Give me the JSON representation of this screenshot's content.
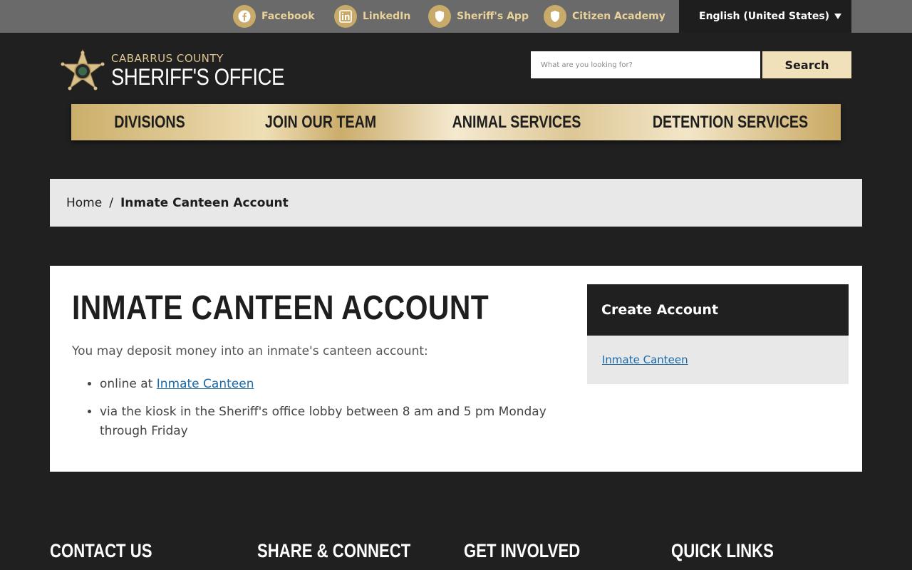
{
  "topbar": {
    "links": [
      {
        "label": "Facebook",
        "icon": "facebook-icon"
      },
      {
        "label": "LinkedIn",
        "icon": "linkedin-icon"
      },
      {
        "label": "Sheriff's App",
        "icon": "shield-icon"
      },
      {
        "label": "Citizen Academy",
        "icon": "shield-icon"
      }
    ],
    "language": "English (United States)"
  },
  "logo": {
    "line1": "CABARRUS COUNTY",
    "line2": "SHERIFF'S OFFICE"
  },
  "search": {
    "placeholder": "What are you looking for?",
    "button_label": "Search"
  },
  "nav": {
    "items": [
      "DIVISIONS",
      "JOIN OUR TEAM",
      "ANIMAL SERVICES",
      "DETENTION SERVICES"
    ]
  },
  "breadcrumb": {
    "home": "Home",
    "separator": "/",
    "current": "Inmate Canteen Account"
  },
  "main": {
    "title": "INMATE CANTEEN ACCOUNT",
    "intro": "You may deposit money into an inmate's canteen account:",
    "bullet1_prefix": "online at ",
    "bullet1_link": "Inmate Canteen",
    "bullet2": "via the kiosk in the Sheriff's office lobby between 8 am and 5 pm Monday through Friday"
  },
  "sidebar": {
    "heading": "Create Account",
    "link": "Inmate Canteen"
  },
  "footer": {
    "headings": [
      "CONTACT US",
      "SHARE & CONNECT",
      "GET INVOLVED",
      "QUICK LINKS"
    ]
  },
  "colors": {
    "background": "#202020",
    "gold_accent": "#c8ab6a",
    "link_blue": "#1a6aa8"
  }
}
